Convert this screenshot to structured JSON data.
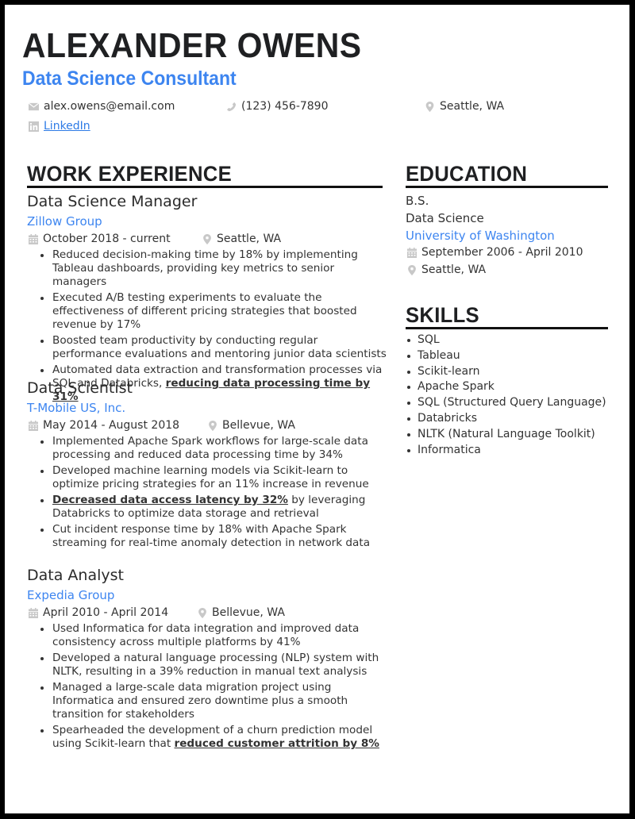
{
  "header": {
    "name": "ALEXANDER OWENS",
    "role": "Data Science Consultant",
    "contact": {
      "email": "alex.owens@email.com",
      "phone": "(123) 456-7890",
      "location": "Seattle, WA",
      "linkedin_label": "LinkedIn"
    },
    "icons": {
      "email": "envelope-icon",
      "phone": "phone-icon",
      "location": "map-pin-icon",
      "linkedin": "linkedin-icon"
    }
  },
  "colors": {
    "accent": "#3d85f0",
    "heading": "#1f2022",
    "text": "#333333",
    "icon": "#c8c8c8",
    "frame": "#000000"
  },
  "work_experience": {
    "title": "WORK EXPERIENCE",
    "jobs": [
      {
        "title": "Data Science Manager",
        "company": "Zillow Group",
        "dates": "October 2018 - current",
        "location": "Seattle, WA",
        "bullets": [
          {
            "text": "Reduced decision-making time by 18% by implementing Tableau dashboards, providing key metrics to senior managers",
            "pre": "",
            "em": "",
            "post": ""
          },
          {
            "text": "Executed A/B testing experiments to evaluate the effectiveness of different pricing strategies that boosted revenue by 17%",
            "pre": "",
            "em": "",
            "post": ""
          },
          {
            "text": "Boosted team productivity by conducting regular performance evaluations and mentoring junior data scientists",
            "pre": "",
            "em": "",
            "post": ""
          },
          {
            "text": "",
            "pre": "Automated data extraction and transformation processes via SQL and Databricks, ",
            "em": "reducing data processing time by 31%",
            "post": ""
          }
        ]
      },
      {
        "title": "Data Scientist",
        "company": "T-Mobile US, Inc.",
        "dates": "May 2014 - August 2018",
        "location": "Bellevue, WA",
        "bullets": [
          {
            "text": "Implemented Apache Spark workflows for large-scale data processing and reduced data processing time by 34%",
            "pre": "",
            "em": "",
            "post": ""
          },
          {
            "text": "Developed machine learning models via Scikit-learn to optimize pricing strategies for an 11% increase in revenue",
            "pre": "",
            "em": "",
            "post": ""
          },
          {
            "text": "",
            "pre": "",
            "em": "Decreased data access latency by 32%",
            "post": " by leveraging Databricks to optimize data storage and retrieval"
          },
          {
            "text": "Cut incident response time by 18% with Apache Spark streaming for real-time anomaly detection in network data",
            "pre": "",
            "em": "",
            "post": ""
          }
        ]
      },
      {
        "title": "Data Analyst",
        "company": "Expedia Group",
        "dates": "April 2010 - April 2014",
        "location": "Bellevue, WA",
        "bullets": [
          {
            "text": "Used Informatica for data integration and improved data consistency across multiple platforms by 41%",
            "pre": "",
            "em": "",
            "post": ""
          },
          {
            "text": "Developed a natural language processing (NLP) system with NLTK, resulting in a 39% reduction in manual text analysis",
            "pre": "",
            "em": "",
            "post": ""
          },
          {
            "text": "Managed a large-scale data migration project using Informatica and ensured zero downtime plus a smooth transition for stakeholders",
            "pre": "",
            "em": "",
            "post": ""
          },
          {
            "text": "",
            "pre": "Spearheaded the development of a churn prediction model using Scikit-learn that ",
            "em": "reduced customer attrition by 8%",
            "post": ""
          }
        ]
      }
    ]
  },
  "education": {
    "title": "EDUCATION",
    "degree": "B.S.",
    "field": "Data Science",
    "school": "University of Washington",
    "dates": "September 2006 - April 2010",
    "location": "Seattle, WA"
  },
  "skills": {
    "title": "SKILLS",
    "items": [
      "SQL",
      "Tableau",
      "Scikit-learn",
      "Apache Spark",
      "SQL (Structured Query Language)",
      "Databricks",
      "NLTK (Natural Language Toolkit)",
      "Informatica"
    ]
  }
}
